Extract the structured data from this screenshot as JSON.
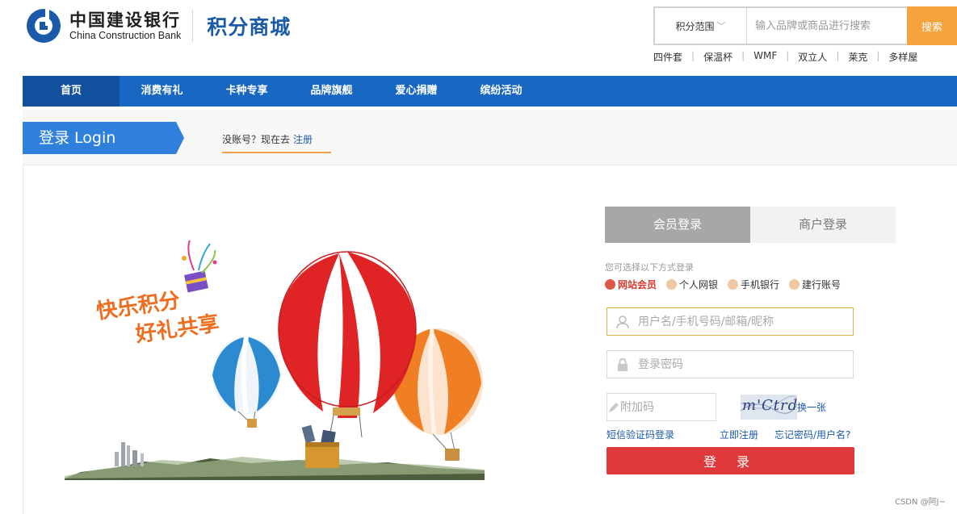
{
  "header": {
    "logo_cn": "中国建设银行",
    "logo_en": "China Construction Bank",
    "mall_title": "积分商城",
    "brand_color": "#1a5aa8"
  },
  "search": {
    "scope_label": "积分范围",
    "placeholder": "输入品牌或商品进行搜索",
    "button_label": "搜索",
    "button_color": "#f6a33c"
  },
  "hot_words": [
    "四件套",
    "保温杯",
    "WMF",
    "双立人",
    "莱克",
    "多样屋"
  ],
  "nav": {
    "items": [
      "首页",
      "消费有礼",
      "卡种专享",
      "品牌旗舰",
      "爱心捐赠",
      "缤纷活动"
    ],
    "active_index": 0,
    "bg_color": "#1868c3"
  },
  "titlebar": {
    "title": "登录 Login",
    "prompt": "没账号？现在去",
    "register_link": "注册"
  },
  "illustration": {
    "slogan_line1": "快乐积分",
    "slogan_line2": "好礼共享"
  },
  "login": {
    "tabs": [
      "会员登录",
      "商户登录"
    ],
    "active_tab": 0,
    "method_hint": "您可选择以下方式登录",
    "methods": [
      "网站会员",
      "个人网银",
      "手机银行",
      "建行账号"
    ],
    "active_method": 0,
    "username_placeholder": "用户名/手机号码/邮箱/昵称",
    "password_placeholder": "登录密码",
    "captcha_placeholder": "附加码",
    "captcha_text": "m'Ctrd",
    "refresh_label": "换一张",
    "sms_login": "短信验证码登录",
    "register_now": "立即注册",
    "forgot": "忘记密码/用户名?",
    "submit_label": "登 录",
    "submit_color": "#e0393c"
  },
  "watermark": "CSDN @阿J~"
}
